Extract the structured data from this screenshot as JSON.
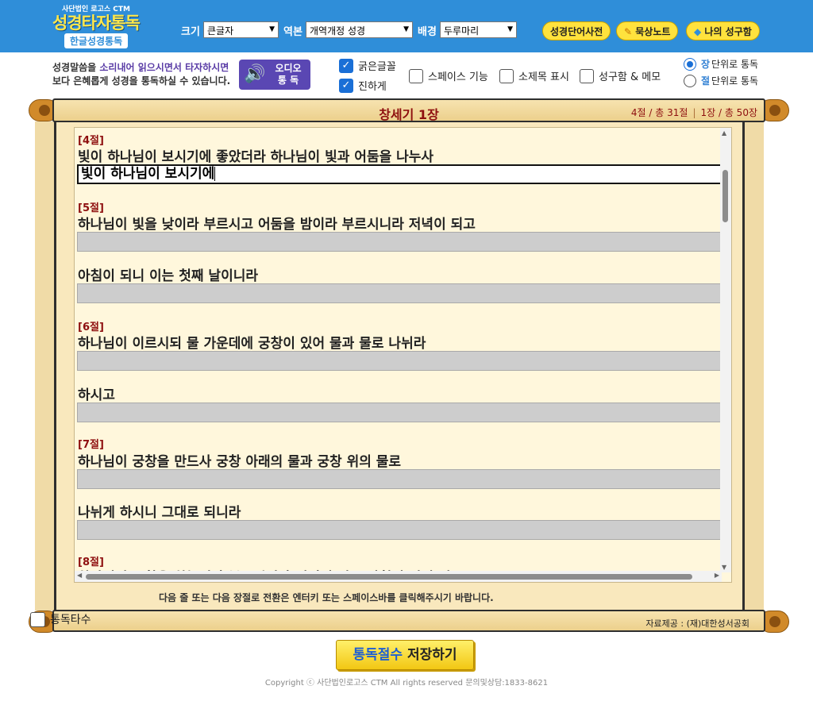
{
  "header": {
    "org": "사단법인 로고스 CTM",
    "title": "성경타자통독",
    "subtitle": "한글성경통독",
    "size_label": "크기",
    "size_value": "큰글자",
    "version_label": "역본",
    "version_value": "개역개정 성경",
    "bg_label": "배경",
    "bg_value": "두루마리",
    "btn_dictionary": "성경단어사전",
    "btn_notes": "묵상노트",
    "btn_verses": "나의 성구함"
  },
  "options": {
    "audio_text_1a": "성경말씀을 ",
    "audio_text_1b": "소리내어 읽으시면서 타자하시면",
    "audio_text_2": "보다 은혜롭게 성경을 통독하실 수 있습니다.",
    "audio_btn_1": "오디오",
    "audio_btn_2": "통 독",
    "bold_font": {
      "label": "굵은글꼴",
      "checked": true
    },
    "darker": {
      "label": "진하게",
      "checked": true
    },
    "space_feature": {
      "label": "스페이스 기능",
      "checked": false
    },
    "subtitle_show": {
      "label": "소제목 표시",
      "checked": false
    },
    "verse_memo": {
      "label": "성구함 & 메모",
      "checked": false
    },
    "radio_chapter_key": "장",
    "radio_chapter_rest": " 단위로 통독",
    "radio_verse_key": "절",
    "radio_verse_rest": " 단위로 통독",
    "selected_mode": "chapter"
  },
  "scroll": {
    "chapter_title": "창세기 1장",
    "verse_position": "4절 / 총 31절",
    "chapter_position": "1장 / 총 50장"
  },
  "content": {
    "v4_num": "[4절]",
    "v4_line": "빛이 하나님이 보시기에 좋았더라 하나님이 빛과 어둠을 나누사",
    "v4_typed": "빛이 하나님이 보시기에",
    "v5_num": "[5절]",
    "v5_line1": "하나님이 빛을 낮이라 부르시고 어둠을 밤이라 부르시니라 저녁이 되고",
    "v5_line2": "아침이 되니 이는 첫째 날이니라",
    "v6_num": "[6절]",
    "v6_line1": "하나님이 이르시되 물 가운데에 궁창이 있어 물과 물로 나뉘라",
    "v6_line2": "하시고",
    "v7_num": "[7절]",
    "v7_line1": "하나님이 궁창을 만드사 궁창 아래의 물과 궁창 위의 물로",
    "v7_line2": "나뉘게 하시니 그대로 되니라",
    "v8_num": "[8절]",
    "v8_partial": "하나님이 궁창을 하늘이라 부르시니라 저녁이 되고 아침이 되니 이는"
  },
  "hint": "다음 줄 또는 다음 장절로 전환은 엔터키 또는 스페이스바를 클릭해주시기 바랍니다.",
  "footer": {
    "tongdok_label": "통독타수",
    "credit": "자료제공 : (재)대한성서공회",
    "save_blue": "통독절수",
    "save_rest": " 저장하기",
    "copyright": "Copyright ⓒ 사단법인로고스 CTM All rights reserved 문의및상담:1833-8621"
  },
  "colors": {
    "header_bg": "#2f8ed9",
    "title_yellow": "#ffe74a",
    "accent_red": "#8e0f0f",
    "parchment": "#f9e8bd"
  }
}
